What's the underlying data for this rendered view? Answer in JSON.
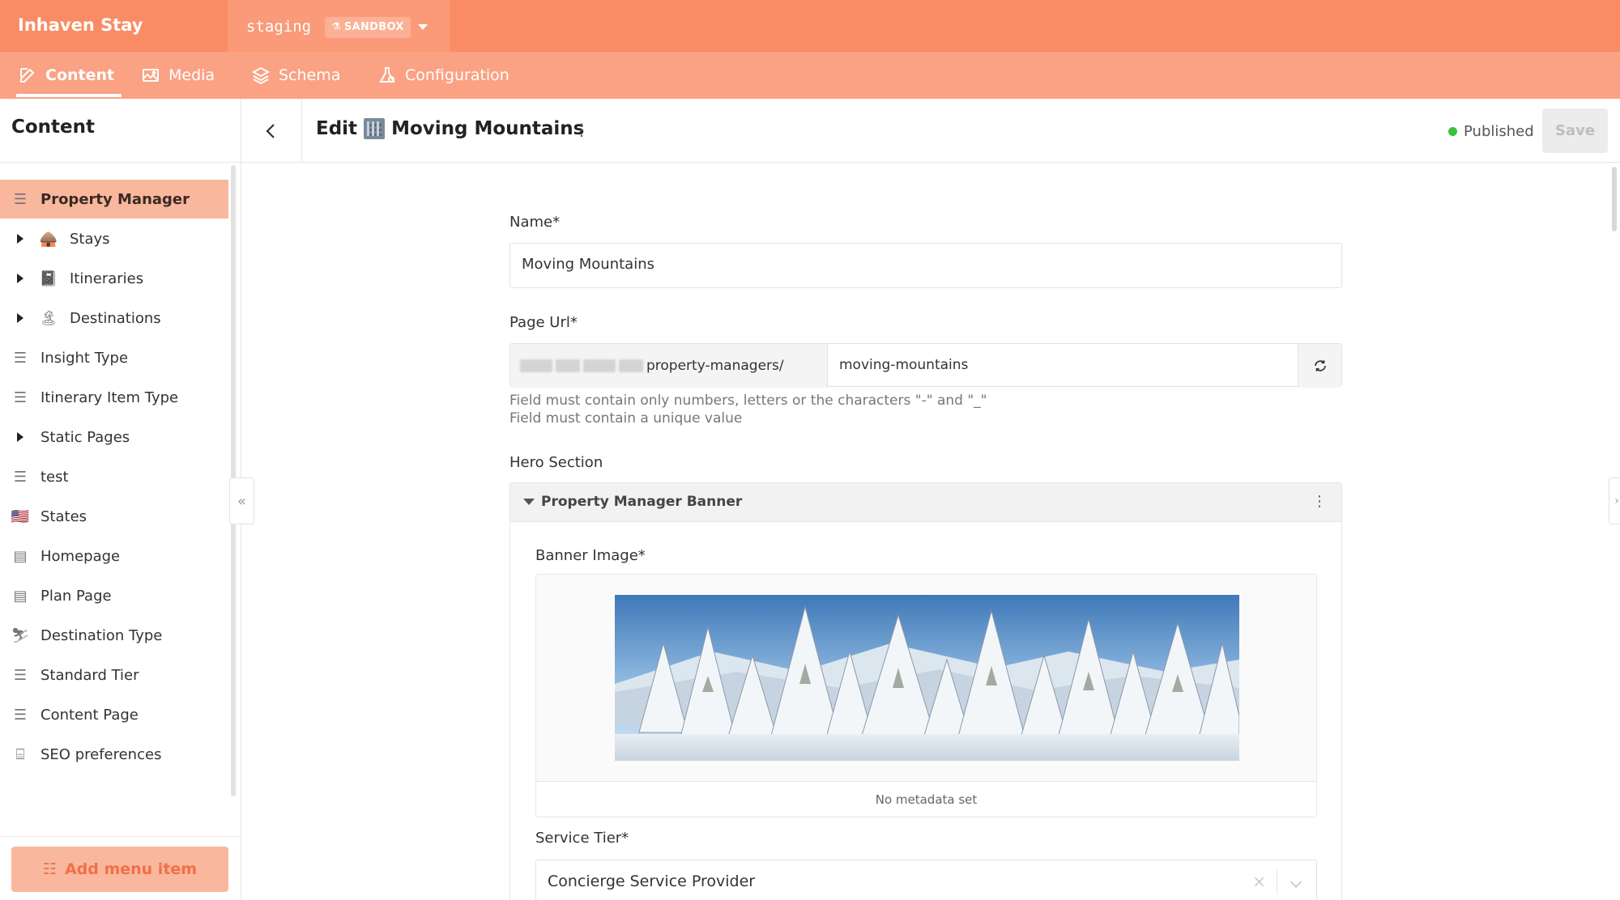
{
  "app": {
    "brand": "Inhaven Stay",
    "environment": "staging",
    "env_badge": "SANDBOX"
  },
  "nav": {
    "tabs": [
      {
        "label": "Content",
        "icon": "edit-icon",
        "active": true
      },
      {
        "label": "Media",
        "icon": "image-icon",
        "active": false
      },
      {
        "label": "Schema",
        "icon": "layers-icon",
        "active": false
      },
      {
        "label": "Configuration",
        "icon": "settings-flask-icon",
        "active": false
      }
    ]
  },
  "sidebar": {
    "title": "Content",
    "items": [
      {
        "label": "Property Manager",
        "icon": "list-icon",
        "active": true,
        "expandable": false
      },
      {
        "label": "Stays",
        "icon": "hut-emoji",
        "active": false,
        "expandable": true
      },
      {
        "label": "Itineraries",
        "icon": "notebook-emoji",
        "active": false,
        "expandable": true
      },
      {
        "label": "Destinations",
        "icon": "island-emoji",
        "active": false,
        "expandable": true
      },
      {
        "label": "Insight Type",
        "icon": "list-icon",
        "active": false,
        "expandable": false
      },
      {
        "label": "Itinerary Item Type",
        "icon": "list-icon",
        "active": false,
        "expandable": false
      },
      {
        "label": "Static Pages",
        "icon": "",
        "active": false,
        "expandable": true
      },
      {
        "label": "test",
        "icon": "list-icon",
        "active": false,
        "expandable": false
      },
      {
        "label": "States",
        "icon": "us-flag-emoji",
        "active": false,
        "expandable": false
      },
      {
        "label": "Homepage",
        "icon": "document-icon",
        "active": false,
        "expandable": false
      },
      {
        "label": "Plan Page",
        "icon": "document-icon",
        "active": false,
        "expandable": false
      },
      {
        "label": "Destination Type",
        "icon": "skier-emoji",
        "active": false,
        "expandable": false
      },
      {
        "label": "Standard Tier",
        "icon": "list-icon",
        "active": false,
        "expandable": false
      },
      {
        "label": "Content Page",
        "icon": "list-icon",
        "active": false,
        "expandable": false
      },
      {
        "label": "SEO preferences",
        "icon": "toolbox-icon",
        "active": false,
        "expandable": false
      }
    ],
    "add_button": "Add menu item"
  },
  "header": {
    "edit_prefix": "Edit",
    "record_title": "Moving Mountains",
    "status": "Published",
    "save_label": "Save"
  },
  "form": {
    "name_label": "Name*",
    "name_value": "Moving Mountains",
    "url_label": "Page Url*",
    "url_prefix": "property-managers/",
    "url_slug": "moving-mountains",
    "url_hint_1": "Field must contain only numbers, letters or the characters \"-\" and \"_\"",
    "url_hint_2": "Field must contain a unique value",
    "hero_label": "Hero Section",
    "block_title": "Property Manager Banner",
    "banner_label": "Banner Image*",
    "banner_meta": "No metadata set",
    "tier_label": "Service Tier*",
    "tier_value": "Concierge Service Provider"
  },
  "colors": {
    "topbar": "#f98c64",
    "navbar": "#faa283",
    "active_item": "#f9b79e",
    "status_green": "#3cc13b"
  }
}
